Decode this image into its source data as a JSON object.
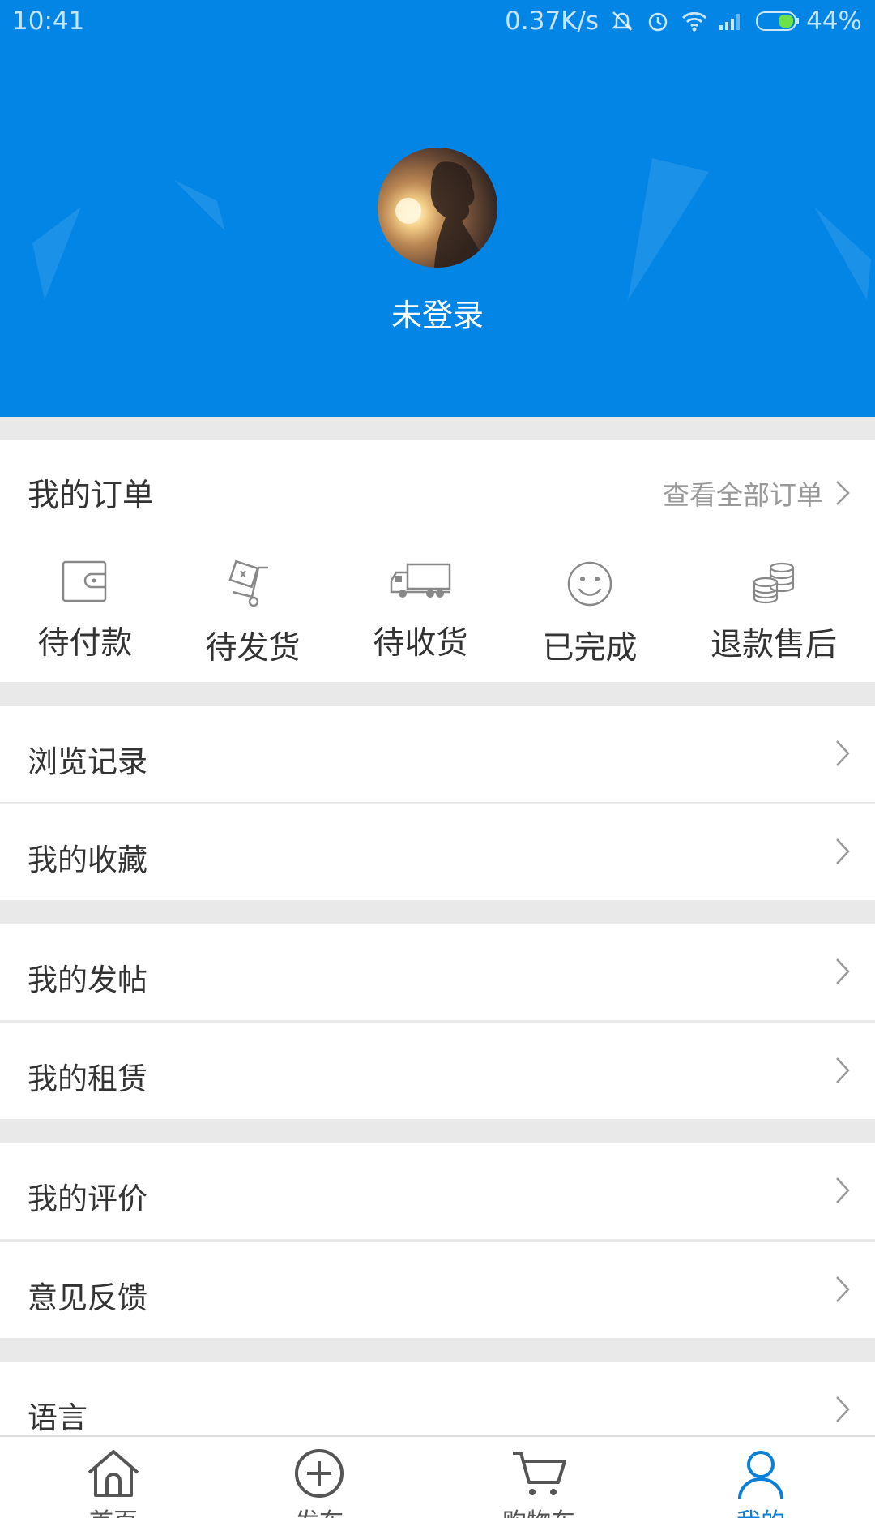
{
  "status_bar": {
    "time": "10:41",
    "network_speed": "0.37K/s",
    "battery": "44%"
  },
  "profile": {
    "login_status": "未登录"
  },
  "orders": {
    "title": "我的订单",
    "view_all": "查看全部订单",
    "items": [
      {
        "label": "待付款",
        "icon": "wallet-icon"
      },
      {
        "label": "待发货",
        "icon": "hand-truck-icon"
      },
      {
        "label": "待收货",
        "icon": "delivery-truck-icon"
      },
      {
        "label": "已完成",
        "icon": "smiley-icon"
      },
      {
        "label": "退款售后",
        "icon": "coins-icon"
      }
    ]
  },
  "menu": [
    {
      "label": "浏览记录"
    },
    {
      "label": "我的收藏"
    },
    {
      "label": "我的发帖"
    },
    {
      "label": "我的租赁"
    },
    {
      "label": "我的评价"
    },
    {
      "label": "意见反馈"
    },
    {
      "label": "语言"
    }
  ],
  "tabbar": {
    "tabs": [
      {
        "label": "首页",
        "icon": "home-icon"
      },
      {
        "label": "发布",
        "icon": "plus-circle-icon"
      },
      {
        "label": "购物车",
        "icon": "cart-icon"
      },
      {
        "label": "我的",
        "icon": "person-icon"
      }
    ],
    "active_index": 3
  },
  "colors": {
    "brand": "#0385e6",
    "active_tab": "#0b7fd6"
  }
}
